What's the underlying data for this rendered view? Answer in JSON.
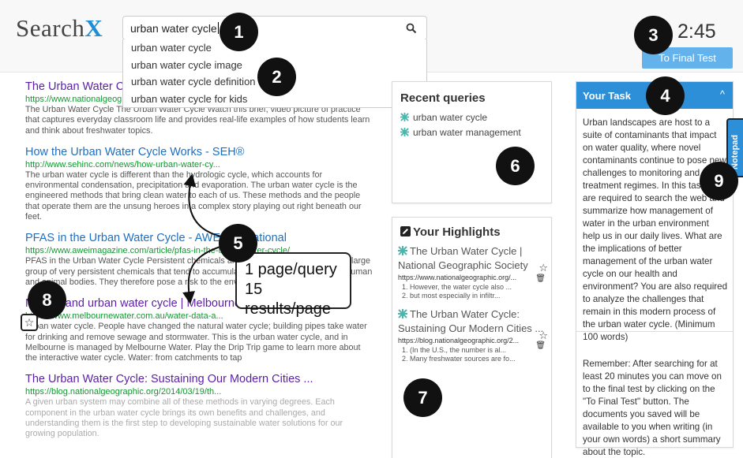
{
  "header": {
    "logo_main": "Search",
    "logo_x": "X",
    "search_value": "urban water cycle",
    "suggestions": [
      "urban water cycle",
      "urban water cycle image",
      "urban water cycle definition",
      "urban water cycle for kids"
    ],
    "timer": "2:45",
    "final_test_label": "To Final Test"
  },
  "results": [
    {
      "title": "The Urban Water Cycle - National Geographic Society",
      "url": "https://www.nationalgeographic.org/media/urban-water-cycle/",
      "snippet": "The Urban Water Cycle The Urban Water Cycle Watch this brief, video picture of practice that captures everyday classroom life and provides real-life examples of how students learn and think about freshwater topics."
    },
    {
      "title": "How the Urban Water Cycle Works - SEH®",
      "url": "http://www.sehinc.com/news/how-urban-water-cy...",
      "snippet": "The urban water cycle is different than the hydrologic cycle, which accounts for environmental condensation, precipitation and evaporation. The urban water cycle is the engineered methods that bring clean water to each of us. These methods and the people that operate them are the unsung heroes in a complex story playing out right beneath our feet."
    },
    {
      "title": "PFAS in the Urban Water Cycle - AWE International",
      "url": "https://www.aweimagazine.com/article/pfas-in-the-urban-water-cycle/",
      "snippet": "PFAS in the Urban Water Cycle Persistent chemicals and the water cycle. PFAS are a large group of very persistent chemicals that tend to accumulate in the environment and in human and animal bodies. They therefore pose a risk to the environment and human health."
    },
    {
      "title": "Natural and urban water cycle | Melbourne Water",
      "url": "https://www.melbournewater.com.au/water-data-a...",
      "snippet": "Urban water cycle. People have changed the natural water cycle; building pipes take water for drinking and remove sewage and stormwater. This is the urban water cycle, and in Melbourne is managed by Melbourne Water. Play the Drip Trip game to learn more about the interactive water cycle. Water: from catchments to tap"
    },
    {
      "title": "The Urban Water Cycle: Sustaining Our Modern Cities ...",
      "url": "https://blog.nationalgeographic.org/2014/03/19/th...",
      "snippet": "A given urban system may combine all of these methods in varying degrees. Each component in the urban water cycle brings its own benefits and challenges, and understanding them is the first step to developing sustainable water solutions for our growing population."
    }
  ],
  "recent": {
    "title": "Recent queries",
    "items": [
      "urban water cycle",
      "urban water management"
    ]
  },
  "highlights": {
    "title": "Your Highlights",
    "docs": [
      {
        "title": "The Urban Water Cycle | National Geographic Society",
        "url": "https://www.nationalgeographic.org/...",
        "notes": [
          "1. However, the water cycle also ...",
          "2. but most especially in infiltr..."
        ]
      },
      {
        "title": "The Urban Water Cycle: Sustaining Our Modern Cities ...",
        "url": "https://blog.nationalgeographic.org/2...",
        "notes": [
          "1. (In the U.S., the number is al...",
          "2. Many freshwater sources are fo..."
        ]
      }
    ]
  },
  "task": {
    "title": "Your Task",
    "chevron": "^",
    "body": "Urban landscapes are host to a suite of contaminants that impact on water quality, where novel contaminants continue to pose new challenges to monitoring and treatment regimes. In this task, you are required to search the web and summarize how management of water in the urban environment help us in our daily lives. What are the implications of better management of the urban water cycle on our health and environment? You are also required to analyze the challenges that remain in this modern process of the urban water cycle. (Minimum 100 words)",
    "reminder": "Remember: After searching for at least 20 minutes you can move on to the final test by clicking on the \"To Final Test\" button. The documents you saved will be available to you when writing (in your own words) a short summary about the topic.",
    "notepad_label": "Notepad"
  },
  "annotations": {
    "badges": [
      "1",
      "2",
      "3",
      "4",
      "5",
      "6",
      "7",
      "8",
      "9"
    ],
    "box_line1": "1 page/query",
    "box_line2": "15 results/page"
  },
  "icons": {
    "search": "magnifier-icon",
    "query": "water-cycle-icon",
    "highlight": "pencil-icon",
    "save": "star-icon",
    "delete": "trash-icon"
  },
  "colors": {
    "brand_blue": "#1e8fd6",
    "visited_link": "#5a1fa6",
    "link": "#1e6fc1",
    "url_green": "#159632",
    "task_header": "#2c8fd8",
    "button": "#64b2ec"
  }
}
